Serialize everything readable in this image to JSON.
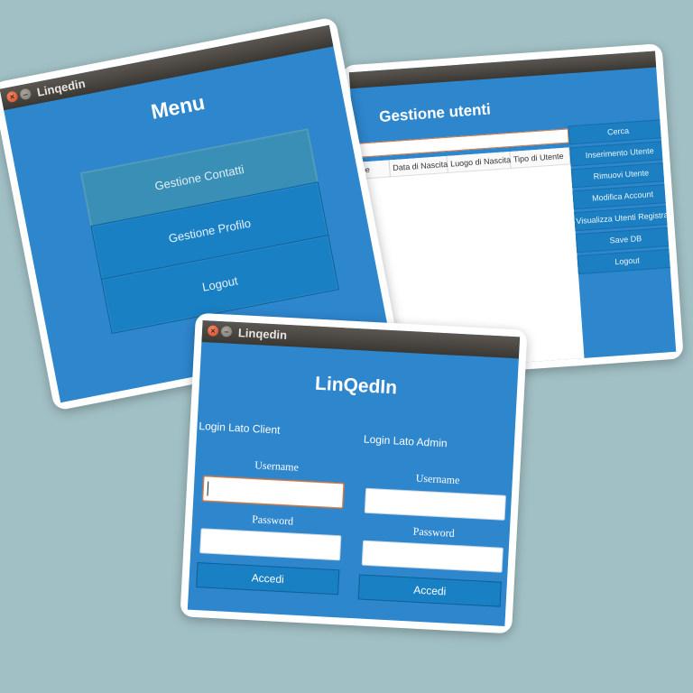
{
  "menu_window": {
    "title": "Linqedin",
    "heading": "Menu",
    "buttons": [
      {
        "label": "Gestione Contatti"
      },
      {
        "label": "Gestione Profilo"
      },
      {
        "label": "Logout"
      }
    ]
  },
  "users_window": {
    "heading": "Gestione utenti",
    "columns": [
      "me",
      "Data di Nascita",
      "Luogo di Nascita",
      "Tipo di Utente"
    ],
    "side_buttons": [
      {
        "label": "Cerca"
      },
      {
        "label": "Inserimento Utente"
      },
      {
        "label": "Rimuovi Utente"
      },
      {
        "label": "Modifica Account"
      },
      {
        "label": "Visualizza Utenti Registrati"
      },
      {
        "label": "Save DB"
      },
      {
        "label": "Logout"
      }
    ]
  },
  "login_window": {
    "title": "Linqedin",
    "heading": "LinQedIn",
    "client": {
      "section_label": "Login Lato Client",
      "username_label": "Username",
      "password_label": "Password",
      "username_value": "",
      "password_value": "",
      "submit_label": "Accedi"
    },
    "admin": {
      "section_label": "Login Lato Admin",
      "username_label": "Username",
      "password_label": "Password",
      "username_value": "",
      "password_value": "",
      "submit_label": "Accedi"
    }
  },
  "colors": {
    "background": "#a1c0c5",
    "window_blue": "#2e86cd",
    "button_blue": "#1a80c4",
    "titlebar": "#3b3834",
    "focus_border": "#e07a3c"
  }
}
